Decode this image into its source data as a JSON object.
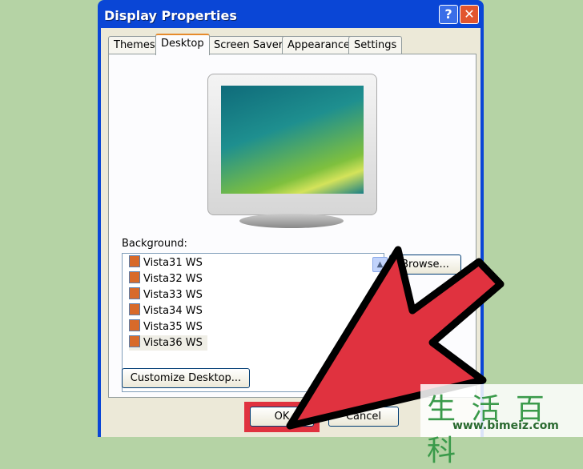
{
  "window": {
    "title": "Display Properties",
    "help_label": "?",
    "close_label": "✕"
  },
  "tabs": [
    {
      "label": "Themes"
    },
    {
      "label": "Desktop",
      "active": true
    },
    {
      "label": "Screen Saver"
    },
    {
      "label": "Appearance"
    },
    {
      "label": "Settings"
    }
  ],
  "background": {
    "label": "Background:",
    "items": [
      "Vista31 WS",
      "Vista32 WS",
      "Vista33 WS",
      "Vista34 WS",
      "Vista35 WS",
      "Vista36 WS"
    ],
    "selected": "Vista36 WS"
  },
  "buttons": {
    "browse": "Browse...",
    "customize": "Customize Desktop...",
    "ok": "OK",
    "cancel": "Cancel"
  },
  "annotation": {
    "arrow_color": "#e0323f",
    "highlight_color": "#e0323f"
  },
  "watermark": {
    "chars": "生 活 百 科",
    "url": "www.bimeiz.com"
  }
}
